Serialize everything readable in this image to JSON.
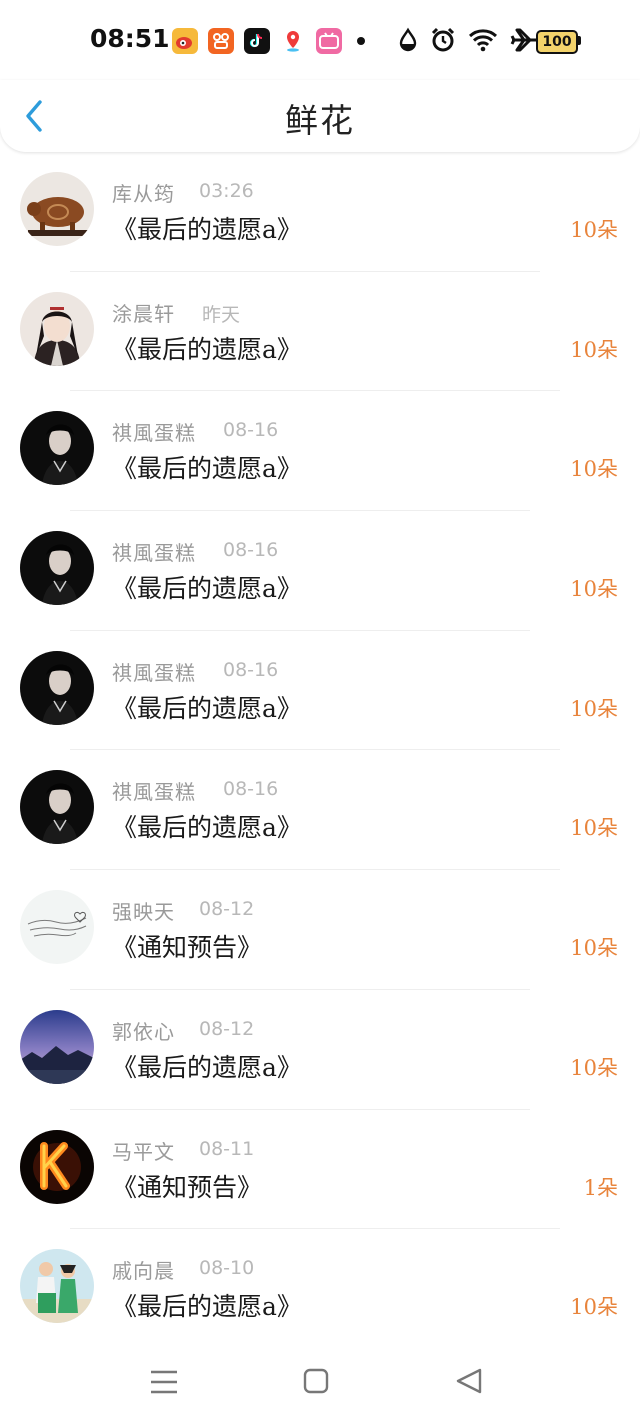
{
  "status_bar": {
    "time": "08:51",
    "battery": "100",
    "app_icons": [
      {
        "name": "weibo-icon",
        "color": "#f6b93b"
      },
      {
        "name": "kuaishou-icon",
        "color": "#f26522"
      },
      {
        "name": "tiktok-icon",
        "color": "#111111"
      },
      {
        "name": "map-pin-icon",
        "color": "#ffffff"
      },
      {
        "name": "bilibili-icon",
        "color": "#f06aa3"
      }
    ]
  },
  "header": {
    "title": "鲜花"
  },
  "colors": {
    "accent_blue": "#2d9cdb",
    "amount_orange": "#e8843c"
  },
  "records": [
    {
      "name": "库从筠",
      "time": "03:26",
      "subject": "《最后的遗愿a》",
      "amount": "10朵",
      "avatar": "pig-statue"
    },
    {
      "name": "涂晨轩",
      "time": "昨天",
      "subject": "《最后的遗愿a》",
      "amount": "10朵",
      "avatar": "ancient-man"
    },
    {
      "name": "祺風蛋糕",
      "time": "08-16",
      "subject": "《最后的遗愿a》",
      "amount": "10朵",
      "avatar": "dark-man"
    },
    {
      "name": "祺風蛋糕",
      "time": "08-16",
      "subject": "《最后的遗愿a》",
      "amount": "10朵",
      "avatar": "dark-man"
    },
    {
      "name": "祺風蛋糕",
      "time": "08-16",
      "subject": "《最后的遗愿a》",
      "amount": "10朵",
      "avatar": "dark-man"
    },
    {
      "name": "祺風蛋糕",
      "time": "08-16",
      "subject": "《最后的遗愿a》",
      "amount": "10朵",
      "avatar": "dark-man"
    },
    {
      "name": "强映天",
      "time": "08-12",
      "subject": "《通知预告》",
      "amount": "10朵",
      "avatar": "handwriting"
    },
    {
      "name": "郭依心",
      "time": "08-12",
      "subject": "《最后的遗愿a》",
      "amount": "10朵",
      "avatar": "landscape"
    },
    {
      "name": "马平文",
      "time": "08-11",
      "subject": "《通知预告》",
      "amount": "1朵",
      "avatar": "fire-k"
    },
    {
      "name": "戚向晨",
      "time": "08-10",
      "subject": "《最后的遗愿a》",
      "amount": "10朵",
      "avatar": "beach-couple"
    }
  ]
}
